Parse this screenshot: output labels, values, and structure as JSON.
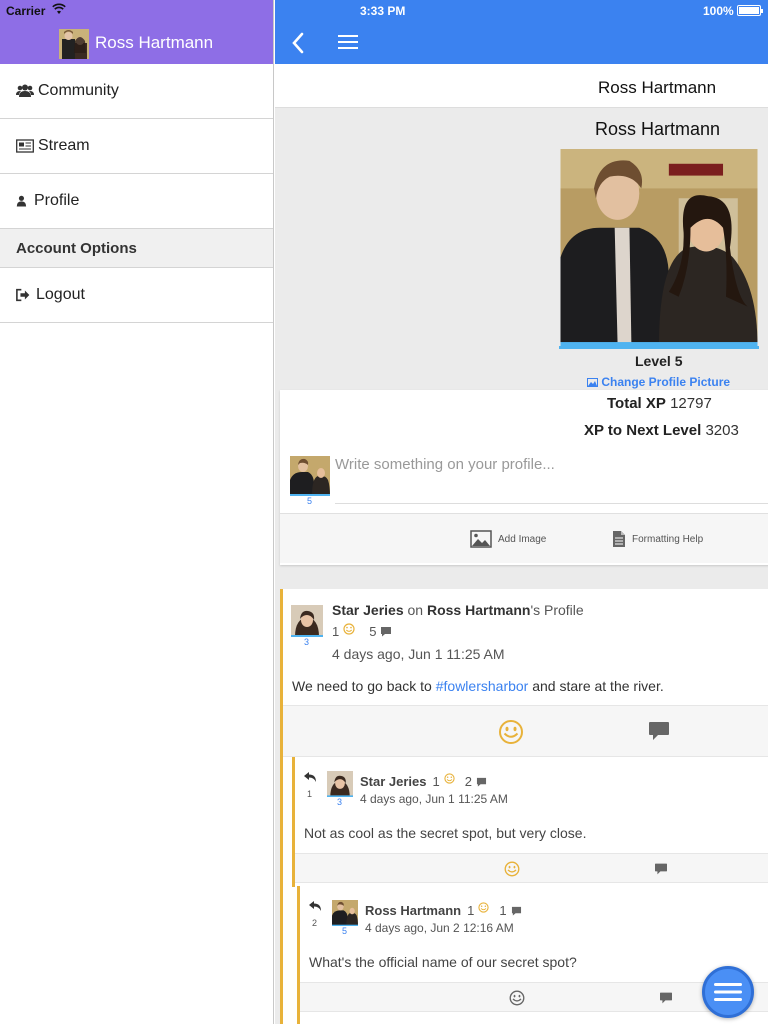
{
  "status_bar": {
    "carrier": "Carrier",
    "time": "3:33 PM",
    "battery": "100%"
  },
  "sidebar": {
    "user_name": "Ross Hartmann",
    "items": [
      {
        "label": "Community",
        "icon": "users-icon"
      },
      {
        "label": "Stream",
        "icon": "newspaper-icon"
      },
      {
        "label": "Profile",
        "icon": "user-icon"
      }
    ],
    "section_title": "Account Options",
    "logout_label": "Logout"
  },
  "header": {
    "title": "Ross Hartmann"
  },
  "profile": {
    "name": "Ross Hartmann",
    "level": "Level 5",
    "change_picture": "Change Profile Picture",
    "total_xp_label": "Total XP",
    "total_xp": "12797",
    "next_level_label": "XP to Next Level",
    "next_level_xp": "3203"
  },
  "composer": {
    "avatar_level": "5",
    "placeholder": "Write something on your profile...",
    "add_image": "Add Image",
    "formatting_help": "Formatting Help"
  },
  "post": {
    "author": "Star Jeries",
    "on_text": "on",
    "target": "Ross Hartmann",
    "suffix": "'s Profile",
    "avatar_level": "3",
    "smiles": "1",
    "comments": "5",
    "time": "4 days ago, Jun 1 11:25 AM",
    "body_before": "We need to go back to",
    "hashtag": "#fowlersharbor",
    "body_after": "and stare at the river."
  },
  "replies": [
    {
      "number": "1",
      "author": "Star Jeries",
      "avatar_level": "3",
      "smiles": "1",
      "comments": "2",
      "time": "4 days ago, Jun 1 11:25 AM",
      "body": "Not as cool as the secret spot, but very close."
    },
    {
      "number": "2",
      "author": "Ross Hartmann",
      "avatar_level": "5",
      "smiles": "1",
      "comments": "1",
      "time": "4 days ago, Jun 2 12:16 AM",
      "body": "What's the official name of our secret spot?"
    }
  ],
  "colors": {
    "accent": "#3b82f0",
    "sidebar_header": "#8e6ee6",
    "post_border": "#e8b23a",
    "smile": "#e8b23a"
  }
}
